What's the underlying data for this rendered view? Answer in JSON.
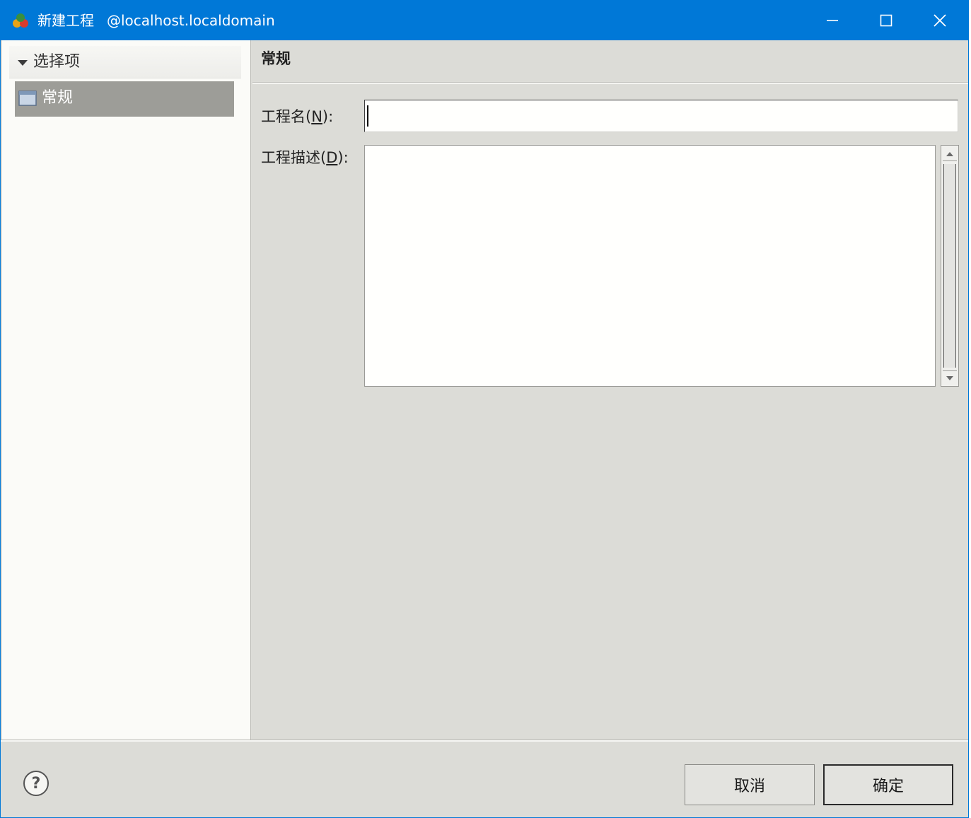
{
  "window": {
    "title": "新建工程",
    "subtitle": "@localhost.localdomain",
    "app_icon": "app-logo-icon",
    "controls": {
      "minimize": "minimize-icon",
      "maximize": "maximize-icon",
      "close": "close-icon"
    },
    "accent_color": "#0078d7"
  },
  "sidebar": {
    "header": "选择项",
    "items": [
      {
        "label": "常规",
        "icon": "page-icon",
        "selected": true
      }
    ]
  },
  "page": {
    "title": "常规",
    "fields": {
      "name": {
        "label_pre": "工程名(",
        "mnemonic": "N",
        "label_post": "):",
        "value": ""
      },
      "description": {
        "label_pre": "工程描述(",
        "mnemonic": "D",
        "label_post": "):",
        "value": ""
      }
    }
  },
  "footer": {
    "help_icon": "help-icon",
    "cancel_label": "取消",
    "ok_label": "确定"
  }
}
